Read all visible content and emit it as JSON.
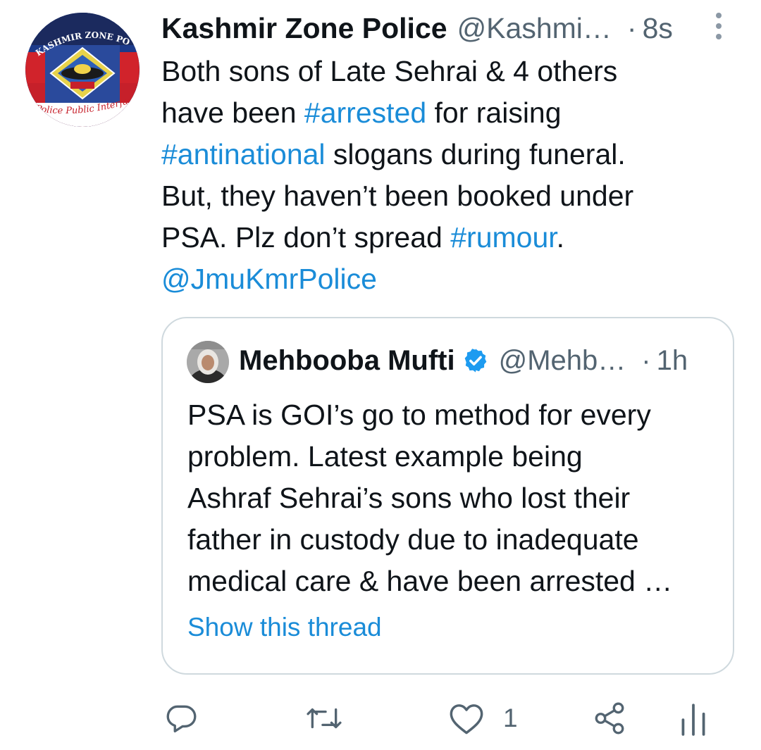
{
  "tweet": {
    "author_name": "Kashmir Zone Police",
    "author_handle": "@Kashmi…",
    "separator": "·",
    "time": "8s",
    "avatar_icon": "kashmir-zone-police-logo",
    "avatar_logo_text_top": "KASHMIR ZONE POLICE MEDIA CENTRE",
    "avatar_logo_text_bottom": "Police Public Interface",
    "lines": [
      [
        {
          "t": "Both sons of Late Sehrai  & 4 others",
          "link": false
        }
      ],
      [
        {
          "t": "have been ",
          "link": false
        },
        {
          "t": "#arrested",
          "link": true
        },
        {
          "t": " for raising",
          "link": false
        }
      ],
      [
        {
          "t": "#antinational",
          "link": true
        },
        {
          "t": " slogans during funeral.",
          "link": false
        }
      ],
      [
        {
          "t": "But, they haven’t been booked under",
          "link": false
        }
      ],
      [
        {
          "t": "PSA. Plz don’t spread ",
          "link": false
        },
        {
          "t": "#rumour",
          "link": true
        },
        {
          "t": ".",
          "link": false
        }
      ],
      [
        {
          "t": "@JmuKmrPolice",
          "link": true
        }
      ]
    ]
  },
  "quoted_tweet": {
    "author_name": "Mehbooba Mufti",
    "verified_icon": "verified-badge-icon",
    "author_handle": "@Mehb…",
    "separator": "·",
    "time": "1h",
    "lines": [
      "PSA is GOI’s go to method for every",
      "problem. Latest example being",
      "Ashraf Sehrai’s sons who lost their",
      "father in custody due to inadequate",
      "medical care & have been arrested …"
    ],
    "show_thread_label": "Show this thread"
  },
  "actions": {
    "reply_icon": "reply-icon",
    "retweet_icon": "retweet-icon",
    "like_icon": "heart-icon",
    "like_count": "1",
    "share_icon": "share-icon",
    "analytics_icon": "analytics-icon"
  },
  "colors": {
    "link": "#1a8cd8",
    "secondary_text": "#536471",
    "primary_text": "#0f1419",
    "border": "#cfd9de",
    "verified": "#1d9bf0"
  }
}
